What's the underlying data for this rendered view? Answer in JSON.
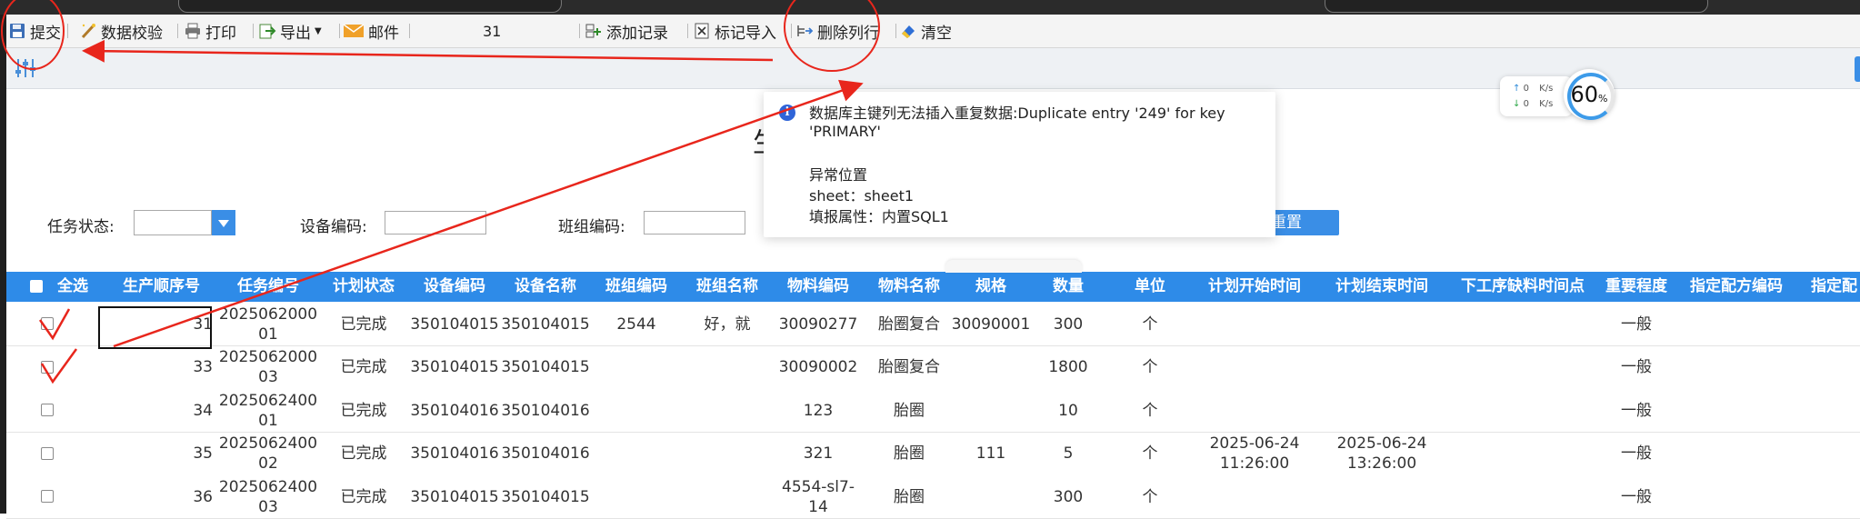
{
  "toolbar": {
    "submit": "提交",
    "validate": "数据校验",
    "print": "打印",
    "export": "导出",
    "mail": "邮件",
    "page_number": "31",
    "add_record": "添加记录",
    "mark_import": "标记导入",
    "delete_row": "删除列行",
    "clear": "清空"
  },
  "filters": {
    "task_status_label": "任务状态:",
    "device_code_label": "设备编码:",
    "team_code_label": "班组编码:",
    "reset_label": "重置"
  },
  "page_title_fragment": "生",
  "error_popup": {
    "message": "数据库主键列无法插入重复数据:Duplicate entry '249' for key 'PRIMARY'",
    "location_title": "异常位置",
    "sheet_line": "sheet：sheet1",
    "attr_line": "填报属性：内置SQL1"
  },
  "net_speed": {
    "up": "0",
    "down": "0",
    "unit": "K/s",
    "percent": "60",
    "percent_sign": "%"
  },
  "table": {
    "headers": [
      "全选",
      "生产顺序号",
      "任务编号",
      "计划状态",
      "设备编码",
      "设备名称",
      "班组编码",
      "班组名称",
      "物料编码",
      "物料名称",
      "规格",
      "数量",
      "单位",
      "计划开始时间",
      "计划结束时间",
      "下工序缺料时间点",
      "重要程度",
      "指定配方编码",
      "指定配"
    ],
    "rows": [
      {
        "seq": "31",
        "task": "2025062000 01",
        "status": "已完成",
        "device_code": "350104015",
        "device_name": "350104015",
        "team_code": "2544",
        "team_name": "好，就",
        "material_code": "30090277",
        "material_name": "胎圈复合",
        "spec": "30090001",
        "qty": "300",
        "unit": "个",
        "start": "",
        "end": "",
        "importance": "一般"
      },
      {
        "seq": "33",
        "task": "2025062000 03",
        "status": "已完成",
        "device_code": "350104015",
        "device_name": "350104015",
        "team_code": "",
        "team_name": "",
        "material_code": "30090002",
        "material_name": "胎圈复合",
        "spec": "",
        "qty": "1800",
        "unit": "个",
        "start": "",
        "end": "",
        "importance": "一般"
      },
      {
        "seq": "34",
        "task": "2025062400 01",
        "status": "已完成",
        "device_code": "350104016",
        "device_name": "350104016",
        "team_code": "",
        "team_name": "",
        "material_code": "123",
        "material_name": "胎圈",
        "spec": "",
        "qty": "10",
        "unit": "个",
        "start": "",
        "end": "",
        "importance": "一般"
      },
      {
        "seq": "35",
        "task": "2025062400 02",
        "status": "已完成",
        "device_code": "350104016",
        "device_name": "350104016",
        "team_code": "",
        "team_name": "",
        "material_code": "321",
        "material_name": "胎圈",
        "spec": "111",
        "qty": "5",
        "unit": "个",
        "start": "2025-06-24 11:26:00",
        "end": "2025-06-24 13:26:00",
        "importance": "一般"
      },
      {
        "seq": "36",
        "task": "2025062400 03",
        "status": "已完成",
        "device_code": "350104015",
        "device_name": "350104015",
        "team_code": "",
        "team_name": "",
        "material_code": "4554-sl7- 14",
        "material_name": "胎圈",
        "spec": "",
        "qty": "300",
        "unit": "个",
        "start": "",
        "end": "",
        "importance": "一般"
      }
    ]
  },
  "colors": {
    "header_blue": "#2e8be8",
    "annotation_red": "#e8261c"
  }
}
